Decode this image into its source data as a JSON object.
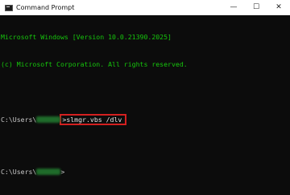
{
  "window": {
    "title": "Command Prompt",
    "controls": {
      "minimize": "—",
      "maximize": "☐",
      "close": "✕"
    }
  },
  "console": {
    "banner_line1": "Microsoft Windows [Version 10.0.21390.2025]",
    "banner_line2": "(c) Microsoft Corporation. All rights reserved.",
    "prompt1_prefix": "C:\\Users\\",
    "prompt1_suffix": ">",
    "command": "slmgr.vbs /dlv",
    "prompt2_prefix": "C:\\Users\\",
    "prompt2_suffix": ">"
  },
  "colors": {
    "console_bg": "#0c0c0c",
    "console_text": "#c8c8c8",
    "banner_text": "#16c60c",
    "highlight_box": "#d42020",
    "titlebar_bg": "#ffffff"
  },
  "icons": {
    "app": "command-prompt-icon"
  }
}
